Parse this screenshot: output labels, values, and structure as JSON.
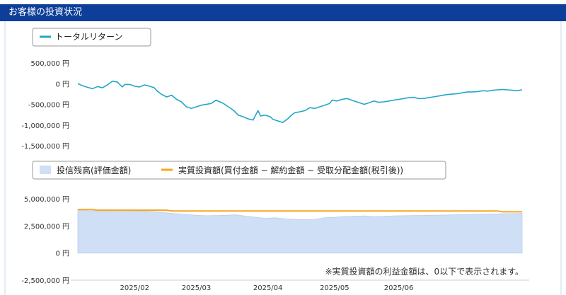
{
  "section_title": "お客様の投資状況",
  "note": "※実質投資額の利益金額は、0以下で表示されます。",
  "colors": {
    "header_bg": "#0d3f9a",
    "total_return_line": "#22a7c7",
    "balance_area": "#cfdff5",
    "net_investment_line": "#f5a623",
    "zero_line": "#9aa0a6"
  },
  "chart_data": [
    {
      "type": "line",
      "legend": [
        "トータルリターン"
      ],
      "legend_placement": "top-left",
      "ylim": [
        -1500000,
        500000
      ],
      "yticks": [
        500000,
        0,
        -500000,
        -1000000,
        -1500000
      ],
      "ytick_labels": [
        "500,000 円",
        "0 円",
        "-500,000 円",
        "-1,000,000 円",
        "-1,500,000 円"
      ],
      "xlim": [
        0,
        180
      ],
      "series": [
        {
          "name": "トータルリターン",
          "x": [
            0,
            2,
            4,
            6,
            8,
            10,
            12,
            14,
            16,
            18,
            19,
            21,
            23,
            25,
            27,
            29,
            31,
            32,
            34,
            36,
            38,
            40,
            42,
            44,
            46,
            48,
            50,
            52,
            54,
            56,
            58,
            59,
            61,
            63,
            65,
            67,
            69,
            71,
            73,
            74,
            76,
            78,
            79,
            81,
            83,
            85,
            87,
            88,
            90,
            92,
            94,
            96,
            98,
            100,
            102,
            103,
            105,
            107,
            109,
            111,
            113,
            115,
            116,
            118,
            120,
            122,
            124,
            126,
            128,
            130,
            132,
            134,
            136,
            138,
            140,
            142,
            144,
            146,
            148,
            150,
            152,
            154,
            156,
            158,
            160,
            162,
            164,
            166,
            168,
            170,
            172,
            174,
            176,
            178,
            180
          ],
          "y": [
            0,
            -50000,
            -90000,
            -120000,
            -70000,
            -100000,
            -30000,
            60000,
            40000,
            -80000,
            -20000,
            -20000,
            -60000,
            -80000,
            -30000,
            -60000,
            -100000,
            -170000,
            -260000,
            -320000,
            -280000,
            -380000,
            -440000,
            -560000,
            -600000,
            -560000,
            -520000,
            -500000,
            -480000,
            -400000,
            -450000,
            -480000,
            -560000,
            -640000,
            -760000,
            -800000,
            -850000,
            -880000,
            -650000,
            -780000,
            -760000,
            -800000,
            -860000,
            -900000,
            -940000,
            -850000,
            -740000,
            -700000,
            -680000,
            -650000,
            -580000,
            -600000,
            -560000,
            -520000,
            -480000,
            -400000,
            -420000,
            -380000,
            -360000,
            -400000,
            -440000,
            -480000,
            -500000,
            -460000,
            -420000,
            -450000,
            -440000,
            -420000,
            -400000,
            -380000,
            -360000,
            -340000,
            -330000,
            -360000,
            -360000,
            -340000,
            -320000,
            -300000,
            -280000,
            -260000,
            -250000,
            -240000,
            -220000,
            -200000,
            -200000,
            -190000,
            -170000,
            -180000,
            -160000,
            -150000,
            -140000,
            -150000,
            -160000,
            -170000,
            -150000
          ]
        }
      ]
    },
    {
      "type": "area",
      "legend": [
        "投信残高(評価金額)",
        "実質投資額(買付金額 − 解約金額 − 受取分配金額(税引後))"
      ],
      "legend_placement": "top-left",
      "ylim": [
        -2500000,
        5000000
      ],
      "yticks": [
        5000000,
        2500000,
        0,
        -2500000
      ],
      "ytick_labels": [
        "5,000,000 円",
        "2,500,000 円",
        "0 円",
        "-2,500,000 円"
      ],
      "xlim": [
        0,
        180
      ],
      "xtick_positions": [
        23,
        48,
        77,
        104,
        130
      ],
      "xtick_labels": [
        "2025/02",
        "2025/03",
        "2025/04",
        "2025/05",
        "2025/06"
      ],
      "series": [
        {
          "name": "投信残高(評価金額)",
          "x": [
            0,
            4,
            8,
            12,
            16,
            20,
            24,
            28,
            32,
            36,
            40,
            44,
            48,
            52,
            56,
            60,
            64,
            68,
            72,
            76,
            80,
            84,
            88,
            92,
            96,
            100,
            104,
            108,
            112,
            116,
            120,
            124,
            128,
            132,
            136,
            140,
            144,
            148,
            152,
            156,
            160,
            164,
            168,
            172,
            176,
            180
          ],
          "y": [
            4000000,
            3900000,
            3880000,
            3900000,
            3920000,
            3900000,
            3880000,
            3860000,
            3780000,
            3700000,
            3620000,
            3560000,
            3480000,
            3440000,
            3460000,
            3480000,
            3520000,
            3400000,
            3300000,
            3200000,
            3250000,
            3150000,
            3100000,
            3060000,
            3100000,
            3250000,
            3300000,
            3360000,
            3400000,
            3420000,
            3360000,
            3380000,
            3420000,
            3440000,
            3460000,
            3470000,
            3480000,
            3500000,
            3520000,
            3540000,
            3560000,
            3580000,
            3600000,
            3620000,
            3640000,
            3650000
          ]
        },
        {
          "name": "実質投資額(買付金額 − 解約金額 − 受取分配金額(税引後))",
          "x": [
            0,
            6,
            8,
            36,
            38,
            170,
            172,
            180
          ],
          "y": [
            4000000,
            4000000,
            3950000,
            3950000,
            3880000,
            3880000,
            3800000,
            3800000
          ]
        }
      ]
    }
  ]
}
